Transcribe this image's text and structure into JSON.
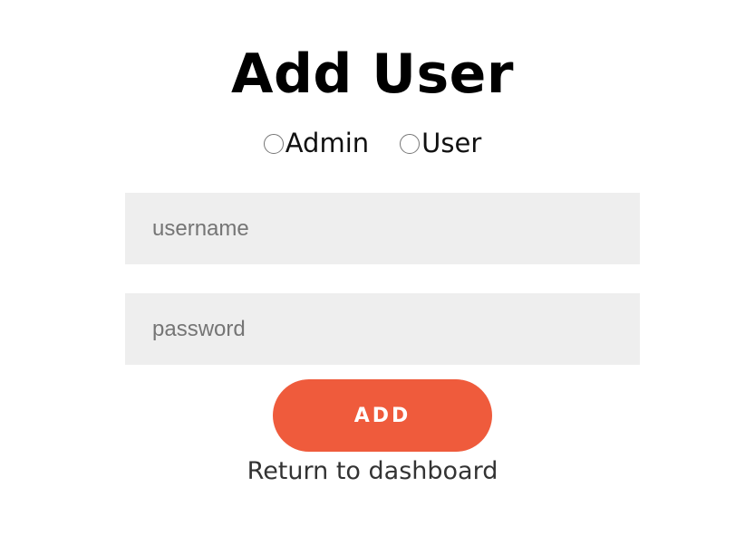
{
  "page": {
    "title": "Add User"
  },
  "role": {
    "options": [
      {
        "label": "Admin",
        "selected": false
      },
      {
        "label": "User",
        "selected": false
      }
    ]
  },
  "form": {
    "username": {
      "placeholder": "username",
      "value": ""
    },
    "password": {
      "placeholder": "password",
      "value": ""
    },
    "submit_label": "ADD"
  },
  "footer": {
    "return_link_label": "Return to dashboard"
  },
  "colors": {
    "accent": "#ef5b3c",
    "field_background": "#eeeeee",
    "text": "#000000"
  }
}
